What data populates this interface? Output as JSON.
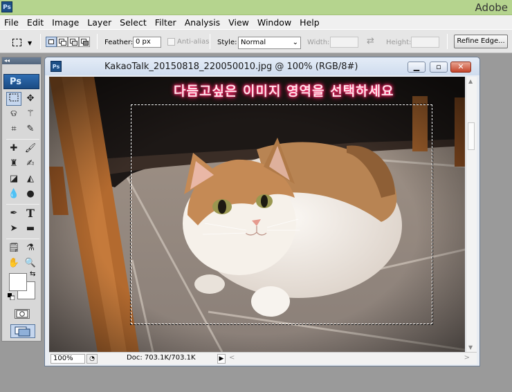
{
  "app": {
    "title": "Adobe",
    "logo": "Ps"
  },
  "menu": {
    "items": [
      {
        "label": "File"
      },
      {
        "label": "Edit"
      },
      {
        "label": "Image"
      },
      {
        "label": "Layer"
      },
      {
        "label": "Select"
      },
      {
        "label": "Filter"
      },
      {
        "label": "Analysis"
      },
      {
        "label": "View"
      },
      {
        "label": "Window"
      },
      {
        "label": "Help"
      }
    ]
  },
  "options": {
    "feather_label": "Feather:",
    "feather_value": "0 px",
    "antialias_label": "Anti-alias",
    "style_label": "Style:",
    "style_value": "Normal",
    "width_label": "Width:",
    "height_label": "Height:",
    "refine_edge_label": "Refine Edge..."
  },
  "toolbox": {
    "logo": "Ps",
    "tools": [
      "rectangular-marquee-icon",
      "move-icon",
      "lasso-icon",
      "magic-wand-icon",
      "crop-icon",
      "eyedropper-slice-icon",
      "healing-brush-icon",
      "brush-icon",
      "clone-stamp-icon",
      "history-brush-icon",
      "eraser-icon",
      "paint-bucket-icon",
      "blur-icon",
      "dodge-icon",
      "pen-icon",
      "type-icon",
      "path-selection-icon",
      "rectangle-shape-icon",
      "notes-icon",
      "eyedropper-icon",
      "hand-icon",
      "zoom-icon"
    ],
    "type_glyph": "T",
    "foreground_color": "#ffffff",
    "background_color": "#ffffff"
  },
  "document": {
    "title": "KakaoTalk_20150818_220050010.jpg @ 100% (RGB/8#)",
    "icon": "Ps",
    "overlay_text": "다듬고싶은 이미지 영역을 선택하세요",
    "zoom": "100%",
    "doc_size": "Doc: 703.1K/703.1K"
  },
  "colors": {
    "titlebar": "#b5d48e",
    "selection": "#ffffff",
    "overlay_glow": "#ff2f6e"
  }
}
